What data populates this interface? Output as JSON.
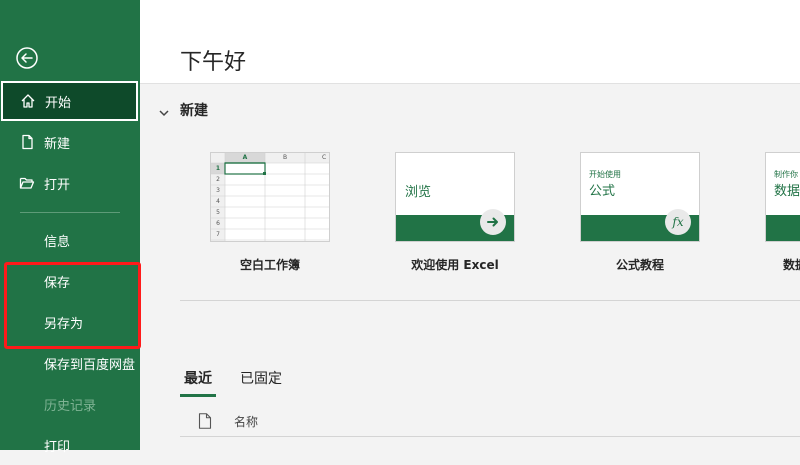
{
  "sidebar": {
    "back_icon": "back-arrow-icon",
    "items": [
      {
        "label": "开始",
        "icon": "home-icon"
      },
      {
        "label": "新建",
        "icon": "new-file-icon"
      },
      {
        "label": "打开",
        "icon": "open-folder-icon"
      },
      {
        "label": "信息"
      },
      {
        "label": "保存"
      },
      {
        "label": "另存为"
      },
      {
        "label": "保存到百度网盘"
      },
      {
        "label": "历史记录"
      },
      {
        "label": "打印"
      }
    ]
  },
  "main": {
    "greeting": "下午好",
    "new_section": {
      "title": "新建",
      "templates": [
        {
          "caption": "空白工作簿",
          "col_headers": [
            "A",
            "B",
            "C"
          ],
          "row_numbers": [
            "1",
            "2",
            "3",
            "4",
            "5",
            "6",
            "7"
          ]
        },
        {
          "caption": "欢迎使用 Excel",
          "thumb_text": "浏览"
        },
        {
          "caption": "公式教程",
          "thumb_small": "开始使用",
          "thumb_big": "公式",
          "icon_text": "fx"
        },
        {
          "caption": "数据",
          "thumb_small": "制作你",
          "thumb_big": "数据"
        }
      ]
    },
    "tabs": [
      "最近",
      "已固定"
    ],
    "list_header": {
      "name_col": "名称"
    }
  },
  "colors": {
    "accent": "#217346",
    "active_nav": "#0e4a2a",
    "highlight": "#ff1a1a"
  }
}
